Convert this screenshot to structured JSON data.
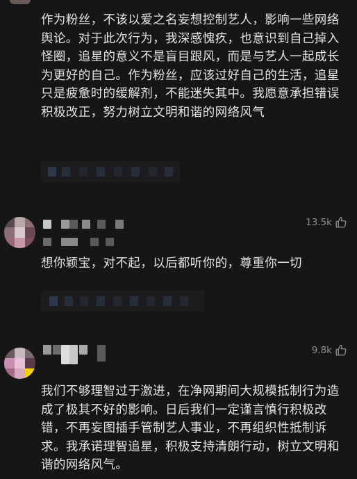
{
  "comments": [
    {
      "text": "作为粉丝，不该以爱之名妄想控制艺人，影响一些网络舆论。对于此次行为，我深感愧疚，也意识到自己掉入怪圈，追星的意义不是盲目跟风，而是与艺人一起成长为更好的自己。作为粉丝，应该过好自己的生活，追星只是疲惫时的缓解剂，不能迷失其中。我愿意承担错误积极改正，努力树立文明和谐的网络风气"
    },
    {
      "likes": "13.5k",
      "text": "想你颖宝，对不起，以后都听你的，尊重你一切"
    },
    {
      "likes": "9.8k",
      "text": "我们不够理智过于激进，在净网期间大规模抵制行为造成了极其不好的影响。日后我们一定谨言慎行积极改错，不再妄图插手管制艺人事业，不再组织性抵制诉求。我承诺理智追星，积极支持清朗行动，树立文明和谐的网络风气。"
    }
  ],
  "icons": {
    "like": "thumbs-up-icon"
  },
  "colors": {
    "background": "#161616",
    "text": "#e4e4e4",
    "meta": "#8e8e8e"
  }
}
